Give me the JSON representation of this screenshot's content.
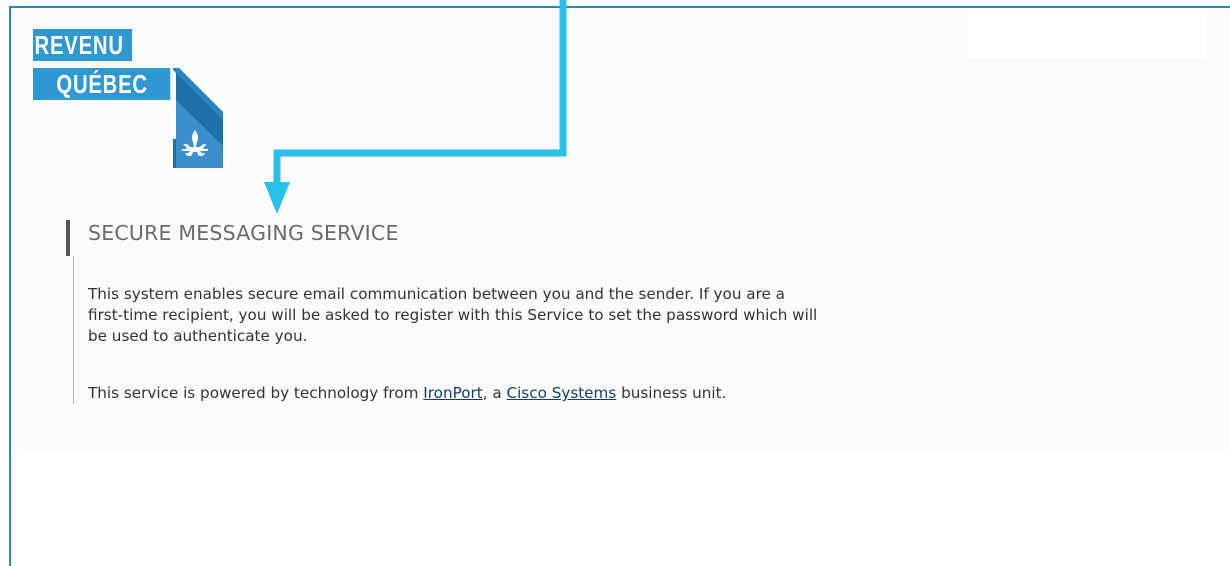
{
  "logo": {
    "line1": "REVENU",
    "line2": "QUÉBEC",
    "brand_color": "#2f97d2",
    "icon": "fleur-de-lis-icon"
  },
  "annotation": {
    "color": "#2bbfec",
    "icon": "arrow-down-icon"
  },
  "content": {
    "title": "SECURE MESSAGING SERVICE",
    "paragraph1_line1": "This system enables secure email communication between you and the sender. If you are a",
    "paragraph1_line2": "first-time recipient, you will be asked to register with this Service to set the password which will",
    "paragraph1_line3": "be used to authenticate you.",
    "paragraph2_before": "This service is powered by technology from ",
    "link1": "IronPort",
    "paragraph2_middle": ", a ",
    "link2": "Cisco Systems",
    "paragraph2_after": " business unit.",
    "link_color": "#123e75"
  }
}
